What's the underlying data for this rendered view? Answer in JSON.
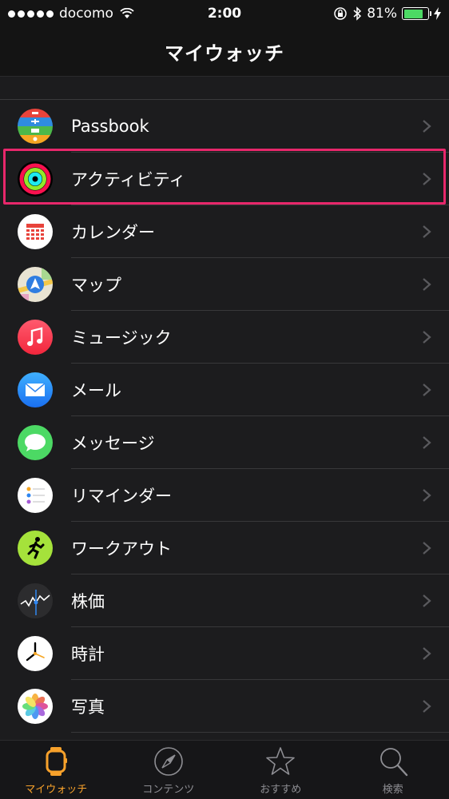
{
  "status_bar": {
    "carrier": "docomo",
    "time": "2:00",
    "battery_percent": "81%",
    "battery_level": 0.81
  },
  "nav": {
    "title": "マイウォッチ"
  },
  "apps": [
    {
      "label": "Passbook",
      "icon": "passbook-icon"
    },
    {
      "label": "アクティビティ",
      "icon": "activity-icon",
      "highlighted": true
    },
    {
      "label": "カレンダー",
      "icon": "calendar-icon"
    },
    {
      "label": "マップ",
      "icon": "maps-icon"
    },
    {
      "label": "ミュージック",
      "icon": "music-icon"
    },
    {
      "label": "メール",
      "icon": "mail-icon"
    },
    {
      "label": "メッセージ",
      "icon": "messages-icon"
    },
    {
      "label": "リマインダー",
      "icon": "reminders-icon"
    },
    {
      "label": "ワークアウト",
      "icon": "workout-icon"
    },
    {
      "label": "株価",
      "icon": "stocks-icon"
    },
    {
      "label": "時計",
      "icon": "clock-icon"
    },
    {
      "label": "写真",
      "icon": "photos-icon"
    }
  ],
  "tabs": [
    {
      "label": "マイウォッチ",
      "icon": "watch-icon",
      "active": true
    },
    {
      "label": "コンテンツ",
      "icon": "compass-icon",
      "active": false
    },
    {
      "label": "おすすめ",
      "icon": "star-icon",
      "active": false
    },
    {
      "label": "検索",
      "icon": "search-icon",
      "active": false
    }
  ],
  "colors": {
    "accent": "#f7a12b",
    "highlight": "#e8276b",
    "battery": "#4cd964",
    "background": "#1c1c1e"
  }
}
